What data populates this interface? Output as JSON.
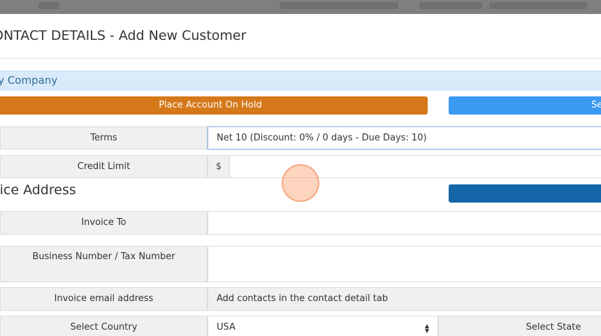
{
  "modal": {
    "title": "ONTACT DETAILS - Add New Customer",
    "company_name": "ay Company"
  },
  "actions": {
    "hold_label": "Place Account On Hold",
    "blue_button_label": "Se",
    "dark_button_label": ""
  },
  "form": {
    "terms_label": "Terms",
    "terms_value": "Net 10 (Discount: 0% / 0 days - Due Days: 10)",
    "credit_limit_label": "Credit Limit",
    "currency_symbol": "$",
    "credit_limit_value": "",
    "invoice_section_title": "oice Address",
    "invoice_to_label": "Invoice To",
    "invoice_to_value": "",
    "tax_number_label": "Business Number / Tax Number",
    "tax_number_value": "",
    "invoice_email_label": "Invoice email address",
    "invoice_email_value": "Add contacts in the contact detail tab",
    "country_label": "Select Country",
    "country_value": "USA",
    "state_label": "Select State"
  },
  "colors": {
    "accent_orange": "#d4781a",
    "accent_blue": "#3a99f0",
    "accent_dark_blue": "#1466a8",
    "company_bar": "#d9ebfa"
  }
}
